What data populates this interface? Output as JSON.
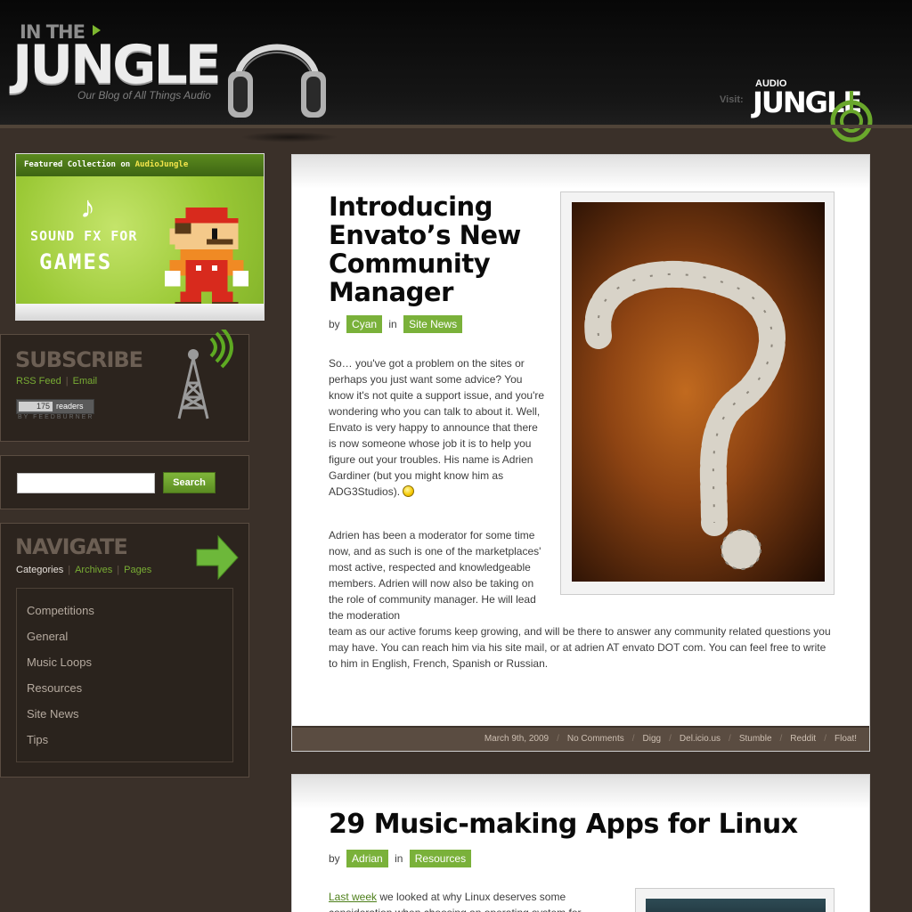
{
  "header": {
    "logo_small": "IN THE",
    "logo_big": "JUNGLE",
    "tagline": "Our Blog of All Things Audio",
    "visit_label": "Visit:",
    "audiojungle_small": "AUDIO",
    "audiojungle_big": "JUNGLE"
  },
  "featured": {
    "label_start": "Featured Collection",
    "label_on": " on ",
    "label_site": "AudioJungle",
    "line1": "SOUND FX FOR",
    "line2": "GAMES"
  },
  "subscribe": {
    "title": "SUBSCRIBE",
    "rss_label": "RSS Feed",
    "separator": "|",
    "email_label": "Email",
    "reader_count": "175",
    "readers_label": "readers",
    "by_feedburner": "BY FEEDBURNER"
  },
  "search": {
    "placeholder": "",
    "button_label": "Search"
  },
  "navigate": {
    "title": "NAVIGATE",
    "tab_categories": "Categories",
    "tab_archives": "Archives",
    "tab_pages": "Pages",
    "items": [
      "Competitions",
      "General",
      "Music Loops",
      "Resources",
      "Site News",
      "Tips"
    ]
  },
  "posts": [
    {
      "title_lines": [
        "Introducing",
        "Envato’s New",
        "Community",
        "Manager"
      ],
      "by_label": "by",
      "author": "Cyan",
      "in_label": "in",
      "category": "Site News",
      "para1": "So… you've got a problem on the sites or perhaps you just want some advice? You know it's not quite a support issue, and you're wondering who you can talk to about it. Well, Envato is very happy to announce that there is now someone whose job it is to help you figure out your troubles. His name is Adrien Gardiner (but you might know him as ADG3Studios).",
      "para2_narrow": "Adrien has been a moderator for some time now, and as such is one of the marketplaces' most active, respected and knowledgeable members. Adrien will now also be taking on the role of community manager. He will lead the moderation",
      "para2_wide": "team as our active forums keep growing, and will be there to answer any community related questions you may have. You can reach him via his site mail, or at adrien AT envato DOT com. You can feel free to write to him in English, French, Spanish or Russian.",
      "footer": {
        "date": "March 9th, 2009",
        "comments": "No Comments",
        "links": [
          "Digg",
          "Del.icio.us",
          "Stumble",
          "Reddit",
          "Float!"
        ],
        "separator": "/"
      }
    },
    {
      "title": "29 Music-making Apps for Linux",
      "by_label": "by",
      "author": "Adrian",
      "in_label": "in",
      "category": "Resources",
      "intro_link": "Last week",
      "intro_text": " we looked at why Linux deserves some consideration when choosing an operating system for"
    }
  ],
  "colors": {
    "accent_green": "#7ab13a",
    "background_brown": "#3a3029",
    "footer_brown": "#5a4c41"
  }
}
